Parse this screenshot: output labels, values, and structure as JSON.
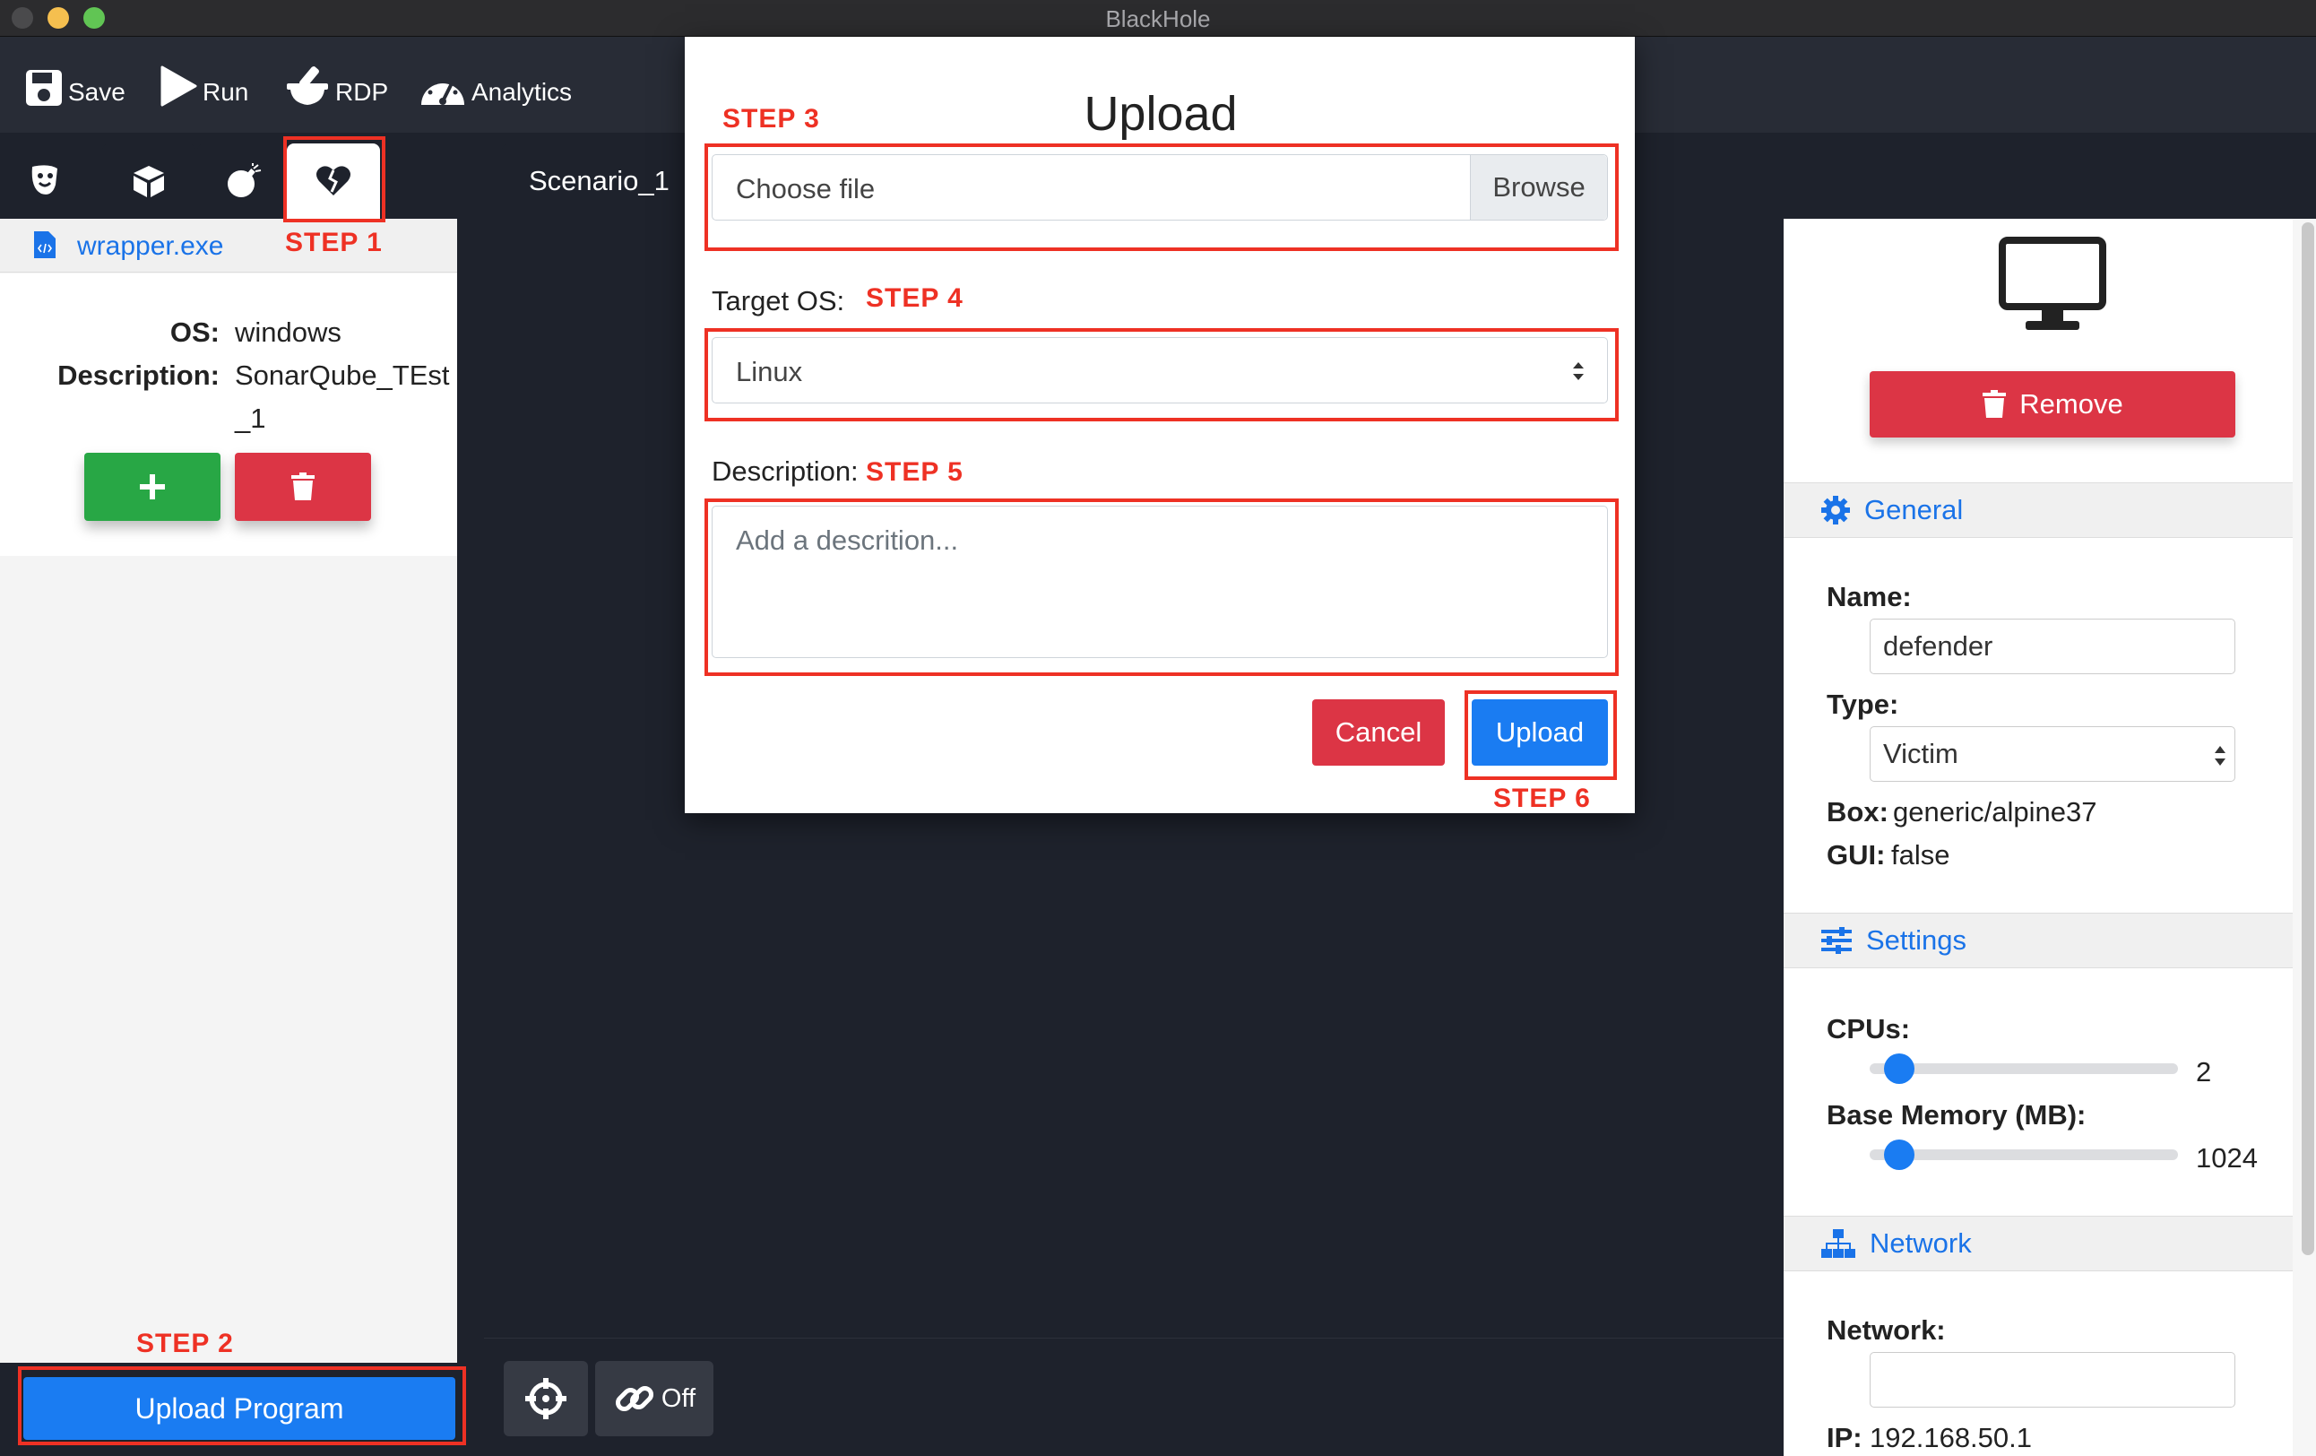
{
  "window": {
    "title": "BlackHole"
  },
  "toolbar": {
    "save": "Save",
    "run": "Run",
    "rdp": "RDP",
    "analytics": "Analytics"
  },
  "left_tabs": [
    {
      "icon": "theater-masks-icon",
      "active": false
    },
    {
      "icon": "box-icon",
      "active": false
    },
    {
      "icon": "bomb-icon",
      "active": false
    },
    {
      "icon": "heart-broken-icon",
      "active": true
    }
  ],
  "scenario_tab": {
    "label": "Scenario_1"
  },
  "left_panel": {
    "file_name": "wrapper.exe",
    "os_label": "OS:",
    "os_value": "windows",
    "description_label": "Description:",
    "description_value_line1": "SonarQube_TEst",
    "description_value_line2": "_1",
    "add_icon": "plus-icon",
    "delete_icon": "trash-icon",
    "upload_program": "Upload Program"
  },
  "canvas_controls": {
    "link_label": "Off"
  },
  "right_panel": {
    "remove": "Remove",
    "general": {
      "header": "General",
      "name_label": "Name:",
      "name_value": "defender",
      "type_label": "Type:",
      "type_value": "Victim",
      "box_label": "Box:",
      "box_value": "generic/alpine37",
      "gui_label": "GUI:",
      "gui_value": "false"
    },
    "settings": {
      "header": "Settings",
      "cpus_label": "CPUs:",
      "cpus_value": "2",
      "memory_label": "Base Memory (MB):",
      "memory_value": "1024"
    },
    "network": {
      "header": "Network",
      "network_label": "Network:",
      "network_value": "",
      "ip_label": "IP:",
      "ip_value": "192.168.50.1"
    }
  },
  "modal": {
    "title": "Upload",
    "file_placeholder": "Choose file",
    "browse": "Browse",
    "target_os_label": "Target OS:",
    "target_os_value": "Linux",
    "description_label": "Description:",
    "description_placeholder": "Add a descrition...",
    "cancel": "Cancel",
    "upload": "Upload"
  },
  "steps": {
    "step1": "STEP 1",
    "step2": "STEP 2",
    "step3": "STEP 3",
    "step4": "STEP 4",
    "step5": "STEP 5",
    "step6": "STEP 6"
  },
  "colors": {
    "accent_blue": "#1a7cf2",
    "danger_red": "#dc3545",
    "success_green": "#28a745",
    "annotation_red": "#ee3124",
    "canvas_bg": "#1e222c"
  }
}
